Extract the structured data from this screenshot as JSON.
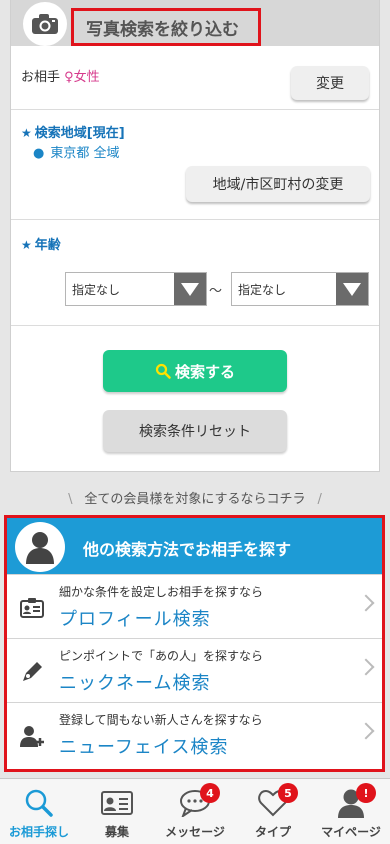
{
  "header": {
    "title": "写真検索を絞り込む",
    "camera_icon": "camera-icon"
  },
  "partner": {
    "label": "お相手",
    "gender": "♀女性",
    "change_button": "変更"
  },
  "area": {
    "label": "検索地域[現在]",
    "value": "東京都 全域",
    "change_button": "地域/市区町村の変更"
  },
  "age": {
    "label": "年齢",
    "min_value": "指定なし",
    "separator": "〜",
    "max_value": "指定なし"
  },
  "actions": {
    "search_button": "検索する",
    "reset_button": "検索条件リセット"
  },
  "note": {
    "text": "全ての会員様を対象にするならコチラ"
  },
  "other_search": {
    "title": "他の検索方法でお相手を探す",
    "items": [
      {
        "small": "細かな条件を設定しお相手を探すなら",
        "big": "プロフィール検索",
        "icon": "profile-card-icon"
      },
      {
        "small": "ピンポイントで「あの人」を探すなら",
        "big": "ニックネーム検索",
        "icon": "pen-icon"
      },
      {
        "small": "登録して間もない新人さんを探すなら",
        "big": "ニューフェイス検索",
        "icon": "add-user-icon"
      }
    ]
  },
  "tabbar": {
    "items": [
      {
        "label": "お相手探し",
        "icon": "search-icon",
        "badge": ""
      },
      {
        "label": "募集",
        "icon": "id-card-icon",
        "badge": ""
      },
      {
        "label": "メッセージ",
        "icon": "chat-icon",
        "badge": "4"
      },
      {
        "label": "タイプ",
        "icon": "heart-icon",
        "badge": "5"
      },
      {
        "label": "マイページ",
        "icon": "person-icon",
        "badge": "!"
      }
    ]
  },
  "colors": {
    "accent": "#1d9bd6",
    "search_green": "#1ec98a",
    "highlight_red": "#e0131b",
    "female_pink": "#d63a8c"
  }
}
